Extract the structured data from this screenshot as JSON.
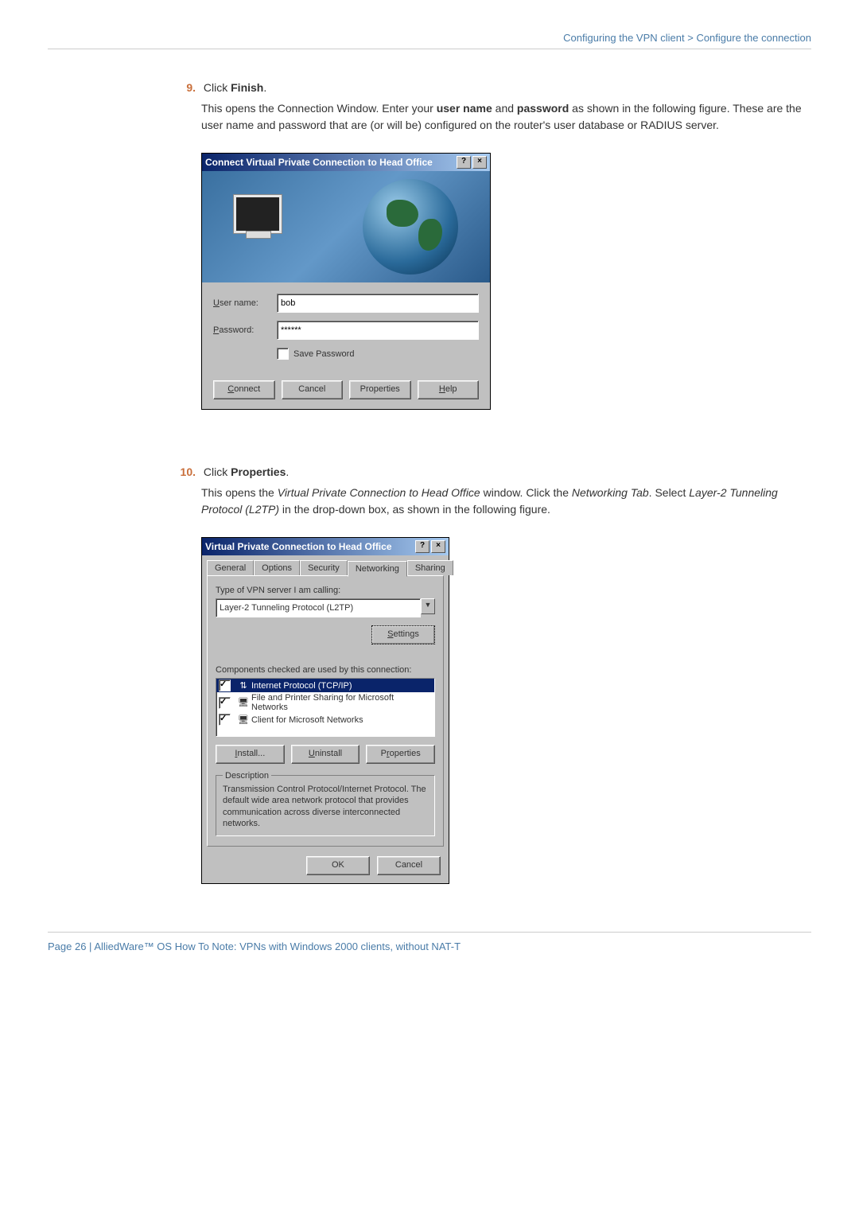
{
  "breadcrumb": "Configuring the VPN client  >  Configure the connection",
  "step9": {
    "num": "9.",
    "prefix": "Click ",
    "bold": "Finish",
    "suffix": ".",
    "body_a": "This opens the Connection Window. Enter your ",
    "body_b": "user name",
    "body_c": " and ",
    "body_d": "password",
    "body_e": " as shown in the following figure. These are the user name and password that are (or will be) configured on the router's user database or RADIUS server."
  },
  "dialog1": {
    "title": "Connect Virtual Private Connection to Head Office",
    "username_label": "User name:",
    "username_value": "bob",
    "password_label": "Password:",
    "password_value": "******",
    "save_password": "Save Password",
    "buttons": {
      "connect": "Connect",
      "cancel": "Cancel",
      "properties": "Properties",
      "help": "Help"
    }
  },
  "step10": {
    "num": "10.",
    "prefix": "Click ",
    "bold": "Properties",
    "suffix": ".",
    "body_a": "This opens the ",
    "body_b": "Virtual Private Connection to Head Office",
    "body_c": " window. Click the ",
    "body_d": "Networking Tab",
    "body_e": ". Select ",
    "body_f": "Layer-2 Tunneling Protocol (L2TP)",
    "body_g": " in the drop-down box, as shown in the following figure."
  },
  "dialog2": {
    "title": "Virtual Private Connection to Head Office",
    "tabs": {
      "general": "General",
      "options": "Options",
      "security": "Security",
      "networking": "Networking",
      "sharing": "Sharing"
    },
    "type_label": "Type of VPN server I am calling:",
    "dropdown_value": "Layer-2 Tunneling Protocol (L2TP)",
    "settings_btn": "Settings",
    "components_label": "Components checked are used by this connection:",
    "components": {
      "tcpip": "Internet Protocol (TCP/IP)",
      "fileprint": "File and Printer Sharing for Microsoft Networks",
      "client": "Client for Microsoft Networks"
    },
    "btns": {
      "install": "Install...",
      "uninstall": "Uninstall",
      "properties": "Properties"
    },
    "desc_label": "Description",
    "desc_text": "Transmission Control Protocol/Internet Protocol. The default wide area network protocol that provides communication across diverse interconnected networks.",
    "ok": "OK",
    "cancel": "Cancel"
  },
  "footer": "Page 26 | AlliedWare™ OS How To Note: VPNs with Windows 2000 clients, without NAT-T"
}
